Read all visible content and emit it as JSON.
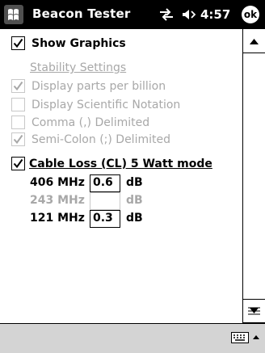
{
  "titlebar": {
    "title": "Beacon Tester",
    "time": "4:57",
    "ok_label": "ok"
  },
  "show_graphics": {
    "label": "Show Graphics",
    "checked": true
  },
  "stability": {
    "title": "Stability Settings",
    "options": [
      {
        "label": "Display parts per billion",
        "checked": true,
        "enabled": false
      },
      {
        "label": "Display Scientific Notation",
        "checked": false,
        "enabled": false
      },
      {
        "label": "Comma (,) Delimited",
        "checked": false,
        "enabled": false
      },
      {
        "label": "Semi-Colon (;) Delimited",
        "checked": true,
        "enabled": false
      }
    ]
  },
  "cable_loss": {
    "label": "Cable Loss  (CL)  5 Watt mode",
    "checked": true,
    "rows": [
      {
        "freq": "406 MHz",
        "value": "0.6",
        "unit": "dB",
        "enabled": true
      },
      {
        "freq": "243 MHz",
        "value": "",
        "unit": "dB",
        "enabled": false
      },
      {
        "freq": "121 MHz",
        "value": "0.3",
        "unit": "dB",
        "enabled": true
      }
    ]
  }
}
